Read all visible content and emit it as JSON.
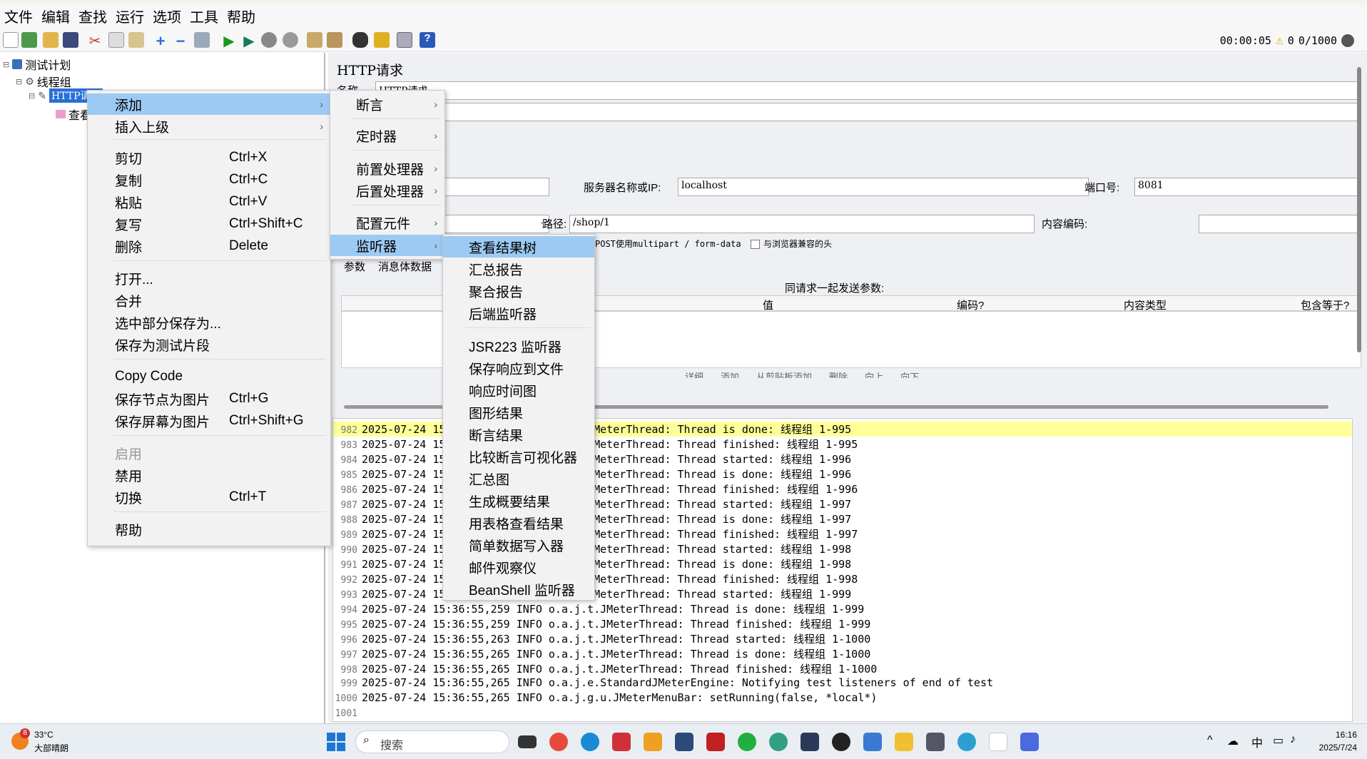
{
  "menubar": [
    "文件",
    "编辑",
    "查找",
    "运行",
    "选项",
    "工具",
    "帮助"
  ],
  "toolbar": {
    "timer": "00:00:05",
    "warnings": "0",
    "threads": "0/1000"
  },
  "tree": {
    "root": "测试计划",
    "group": "线程组",
    "request": "HTTP请求",
    "child": "查看"
  },
  "panel": {
    "title": "HTTP请求",
    "name_label": "名称",
    "name_value": "HTTP请求",
    "server_label": "服务器名称或IP:",
    "server_value": "localhost",
    "port_label": "端口号:",
    "port_value": "8081",
    "path_label": "路径:",
    "path_value": "/shop/1",
    "encoding_label": "内容编码:",
    "multipart": "POST使用multipart / form-data",
    "browser_headers": "与浏览器兼容的头",
    "tab_params": "参数",
    "tab_body": "消息体数据",
    "params_title": "同请求一起发送参数:",
    "col_value": "值",
    "col_encode": "编码?",
    "col_ctype": "内容类型",
    "col_include": "包含等于?",
    "btn_detail": "详细",
    "btn_add": "添加",
    "btn_clip": "从剪贴板添加",
    "btn_del": "删除",
    "btn_up": "向上",
    "btn_down": "向下"
  },
  "menu1": {
    "items": [
      {
        "label": "添加",
        "key": "",
        "arrow": true
      },
      {
        "label": "插入上级",
        "key": "",
        "arrow": true
      },
      {
        "label": "剪切",
        "key": "Ctrl+X"
      },
      {
        "label": "复制",
        "key": "Ctrl+C"
      },
      {
        "label": "粘贴",
        "key": "Ctrl+V"
      },
      {
        "label": "复写",
        "key": "Ctrl+Shift+C"
      },
      {
        "label": "删除",
        "key": "Delete"
      },
      {
        "label": "打开...",
        "key": ""
      },
      {
        "label": "合并",
        "key": ""
      },
      {
        "label": "选中部分保存为...",
        "key": ""
      },
      {
        "label": "保存为测试片段",
        "key": ""
      },
      {
        "label": "Copy Code",
        "key": ""
      },
      {
        "label": "保存节点为图片",
        "key": "Ctrl+G"
      },
      {
        "label": "保存屏幕为图片",
        "key": "Ctrl+Shift+G"
      },
      {
        "label": "启用",
        "key": ""
      },
      {
        "label": "禁用",
        "key": ""
      },
      {
        "label": "切换",
        "key": "Ctrl+T"
      },
      {
        "label": "帮助",
        "key": ""
      }
    ]
  },
  "menu2": {
    "items": [
      "断言",
      "定时器",
      "前置处理器",
      "后置处理器",
      "配置元件",
      "监听器"
    ]
  },
  "menu3": {
    "items": [
      "查看结果树",
      "汇总报告",
      "聚合报告",
      "后端监听器",
      "JSR223 监听器",
      "保存响应到文件",
      "响应时间图",
      "图形结果",
      "断言结果",
      "比较断言可视化器",
      "汇总图",
      "生成概要结果",
      "用表格查看结果",
      "简单数据写入器",
      "邮件观察仪",
      "BeanShell 监听器"
    ]
  },
  "log": [
    {
      "n": "982",
      "date": "2025-07-24 15",
      "rest": "JMeterThread: Thread is done: 线程组 1-995"
    },
    {
      "n": "983",
      "date": "2025-07-24 15",
      "rest": "JMeterThread: Thread finished: 线程组 1-995"
    },
    {
      "n": "984",
      "date": "2025-07-24 15",
      "rest": "JMeterThread: Thread started: 线程组 1-996"
    },
    {
      "n": "985",
      "date": "2025-07-24 15",
      "rest": "JMeterThread: Thread is done: 线程组 1-996"
    },
    {
      "n": "986",
      "date": "2025-07-24 15",
      "rest": "JMeterThread: Thread finished: 线程组 1-996"
    },
    {
      "n": "987",
      "date": "2025-07-24 15",
      "rest": "JMeterThread: Thread started: 线程组 1-997"
    },
    {
      "n": "988",
      "date": "2025-07-24 15",
      "rest": "JMeterThread: Thread is done: 线程组 1-997"
    },
    {
      "n": "989",
      "date": "2025-07-24 15",
      "rest": "JMeterThread: Thread finished: 线程组 1-997"
    },
    {
      "n": "990",
      "date": "2025-07-24 15",
      "rest": "JMeterThread: Thread started: 线程组 1-998"
    },
    {
      "n": "991",
      "date": "2025-07-24 15",
      "rest": "JMeterThread: Thread is done: 线程组 1-998"
    },
    {
      "n": "992",
      "date": "2025-07-24 15",
      "rest": "JMeterThread: Thread finished: 线程组 1-998"
    },
    {
      "n": "993",
      "date": "2025-07-24 15",
      "rest": "JMeterThread: Thread started: 线程组 1-999"
    },
    {
      "n": "994",
      "date": "2025-07-24 15:36:55,259 INFO o.a.j.t.",
      "rest": "JMeterThread: Thread is done: 线程组 1-999"
    },
    {
      "n": "995",
      "date": "2025-07-24 15:36:55,259 INFO o.a.j.t.",
      "rest": "JMeterThread: Thread finished: 线程组 1-999"
    },
    {
      "n": "996",
      "date": "2025-07-24 15:36:55,263 INFO o.a.j.t.",
      "rest": "JMeterThread: Thread started: 线程组 1-1000"
    },
    {
      "n": "997",
      "date": "2025-07-24 15:36:55,265 INFO o.a.j.t.",
      "rest": "JMeterThread: Thread is done: 线程组 1-1000"
    },
    {
      "n": "998",
      "date": "2025-07-24 15:36:55,265 INFO o.a.j.t.",
      "rest": "JMeterThread: Thread finished: 线程组 1-1000"
    },
    {
      "n": "999",
      "date": "2025-07-24 15:36:55,265 INFO o.a.j.e.",
      "rest": "StandardJMeterEngine: Notifying test listeners of end of test"
    },
    {
      "n": "1000",
      "date": "2025-07-24 15:36:55,265 INFO o.a.j.g.u.",
      "rest": "JMeterMenuBar: setRunning(false, *local*)"
    },
    {
      "n": "1001",
      "date": "",
      "rest": ""
    }
  ],
  "taskbar": {
    "temp": "33°C",
    "weather": "大部晴朗",
    "badge": "8",
    "search": "搜索",
    "ime": "中",
    "time": "16:16",
    "date": "2025/7/24"
  }
}
